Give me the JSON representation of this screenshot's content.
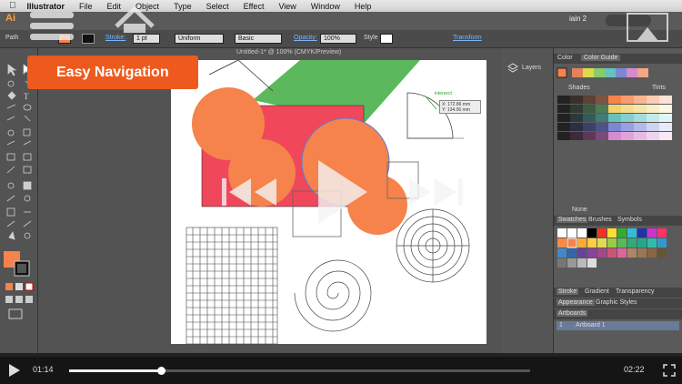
{
  "menubar": {
    "app_name": "Illustrator",
    "items": [
      "File",
      "Edit",
      "Object",
      "Type",
      "Select",
      "Effect",
      "View",
      "Window",
      "Help"
    ]
  },
  "titlebar": {
    "workspace": "iain 2"
  },
  "controlbar": {
    "selection_label": "Path",
    "stroke_label": "Stroke:",
    "stroke_weight": "1 pt",
    "profile": "Uniform",
    "brush": "Basic",
    "opacity_label": "Opacity:",
    "opacity_value": "100%",
    "style_label": "Style",
    "transform_label": "Transform"
  },
  "document": {
    "tab_title": "Untitled-1* @ 100% (CMYK/Preview)"
  },
  "overlay": {
    "banner": "Easy Navigation",
    "readout_x": "X: 172.86 mm",
    "readout_y": "Y: 134.06 mm",
    "smart_guide": "intersect"
  },
  "dock": {
    "layers_label": "Layers"
  },
  "panels": {
    "color_tab": "Color",
    "color_guide_tab": "Color Guide",
    "shades": "Shades",
    "tints": "Tints",
    "none_label": "None",
    "swatches_tab": "Swatches",
    "brushes_tab": "Brushes",
    "symbols_tab": "Symbols",
    "stroke_tab": "Stroke",
    "gradient_tab": "Gradient",
    "transparency_tab": "Transparency",
    "appearance_tab": "Appearance",
    "graphic_styles_tab": "Graphic Styles",
    "artboards_tab": "Artboards",
    "artboard_index": "1",
    "artboard_name": "Artboard 1"
  },
  "player": {
    "elapsed": "01:14",
    "total": "02:22",
    "progress": 0.2
  },
  "colors": {
    "accent_orange": "#ee5a1e",
    "shape_orange": "#f5834b",
    "shape_red": "#f0475a",
    "shape_green": "#5cb85c"
  }
}
